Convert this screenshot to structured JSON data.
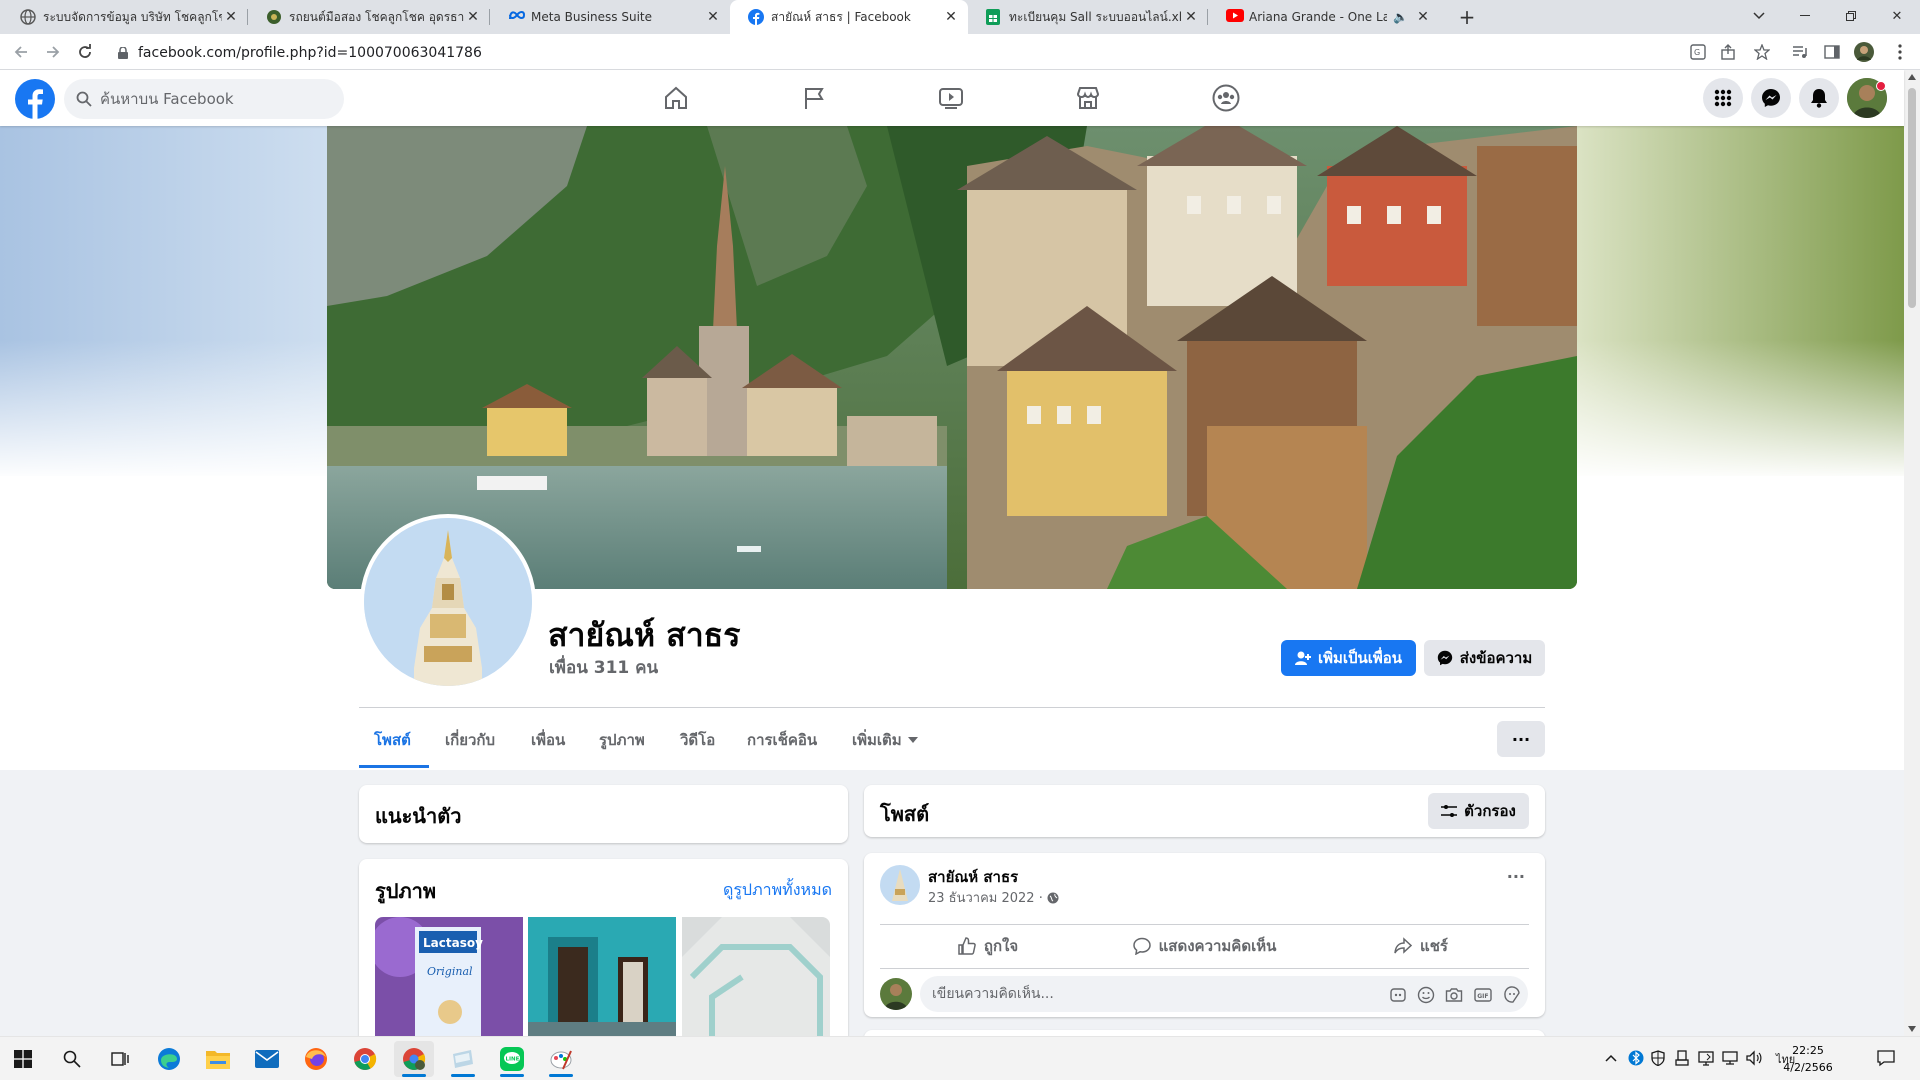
{
  "browser": {
    "tabs": [
      {
        "title": "ระบบจัดการข้อมูล บริษัท โชคลูกโชค อุดรธานี",
        "icon": "globe-icon"
      },
      {
        "title": "รถยนต์มือสอง โชคลูกโชค อุดรธานี",
        "icon": "site-icon"
      },
      {
        "title": "Meta Business Suite",
        "icon": "meta-icon"
      },
      {
        "title": "สายัณห์ สาธร | Facebook",
        "icon": "facebook-icon"
      },
      {
        "title": "ทะเบียนคุม Sall ระบบออนไลน์.xlsx - Google ชีต",
        "icon": "sheets-icon"
      },
      {
        "title": "Ariana Grande - One Last Time",
        "icon": "youtube-icon"
      }
    ],
    "active_tab": 3,
    "url": "facebook.com/profile.php?id=100070063041786"
  },
  "facebook": {
    "search_placeholder": "ค้นหาบน Facebook"
  },
  "profile": {
    "name": "สายัณห์ สาธร",
    "friends": "เพื่อน 311 คน",
    "add_friend": "เพิ่มเป็นเพื่อน",
    "message": "ส่งข้อความ",
    "tabs": [
      "โพสต์",
      "เกี่ยวกับ",
      "เพื่อน",
      "รูปภาพ",
      "วิดีโอ",
      "การเช็คอิน",
      "เพิ่มเติม"
    ],
    "more_dots": "···"
  },
  "intro": {
    "title": "แนะนำตัว"
  },
  "photos": {
    "title": "รูปภาพ",
    "see_all": "ดูรูปภาพทั้งหมด",
    "photo1_brand": "Lactasoy",
    "photo1_label": "Original"
  },
  "posts": {
    "title": "โพสต์",
    "filter": "ตัวกรอง",
    "post": {
      "author": "สายัณห์ สาธร",
      "date": "23 ธันวาคม 2022 ·",
      "more": "···",
      "like": "ถูกใจ",
      "comment": "แสดงความคิดเห็น",
      "share": "แชร์",
      "comment_placeholder": "เขียนความคิดเห็น..."
    }
  },
  "taskbar": {
    "lang": "ไทย",
    "time": "22:25",
    "date": "4/2/2566"
  },
  "colors": {
    "facebook_blue": "#1877f2",
    "tab_active": "#1b74e4"
  }
}
